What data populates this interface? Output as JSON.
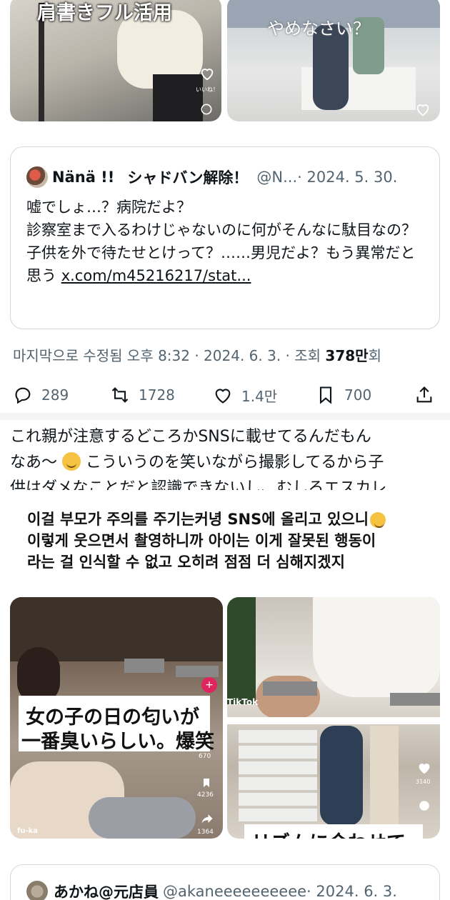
{
  "top_images": {
    "left_caption": "肩書きフル活用",
    "left_like_label": "いいね！",
    "right_caption": "やめなさい？"
  },
  "quote": {
    "name": "Nänä !!",
    "name_suffix": "シャドバン解除！",
    "handle": "@N...",
    "date": "· 2024. 5. 30.",
    "lines": [
      "嘘でしょ…？病院だよ？",
      "診察室まで入るわけじゃないのに何がそんなに駄目なの？",
      "子供を外で待たせとけって？……男児だよ？もう異常だと思う"
    ],
    "link": "x.com/m45216217/stat..."
  },
  "meta": {
    "prefix": "마지막으로 수정됨 오후 8:32 · 2024. 6. 3. · 조회 ",
    "views": "378만",
    "suffix": "회"
  },
  "actions": {
    "replies": "289",
    "reposts": "1728",
    "likes": "1.4만",
    "bookmarks": "700"
  },
  "reply": {
    "line1": "これ親が注意するどころかSNSに載せてるんだもん",
    "line2a": "なあ～",
    "line2b": " こういうのを笑いながら撮影してるから子",
    "line3": "供はダメなことだと認識できないし、むしろエスカレ"
  },
  "translation": {
    "line1": "이걸 부모가 주의를 주기는커녕 SNS에 올리고 있으니",
    "line2": "이렇게 웃으면서 촬영하니까 아이는 이게 잘못된 행동이",
    "line3": "라는 걸 인식할 수 없고 오히려 점점 더 심해지겠지"
  },
  "bottom_images": {
    "left_caption_1": "女の子の日の匂いが",
    "left_caption_2": "一番臭いらしい。爆笑",
    "left_like_count": "670",
    "left_bookmark_count": "4236",
    "left_share_count": "1364",
    "left_user": "fu-ka",
    "right_tiktok": "TikTok",
    "right_caption": "リズムに合わせて",
    "right_like_count": "3140"
  },
  "next_tweet": {
    "name": "あかね@元店員",
    "handle": "@akaneeeeeeeeee",
    "date": "· 2024. 6. 3."
  }
}
